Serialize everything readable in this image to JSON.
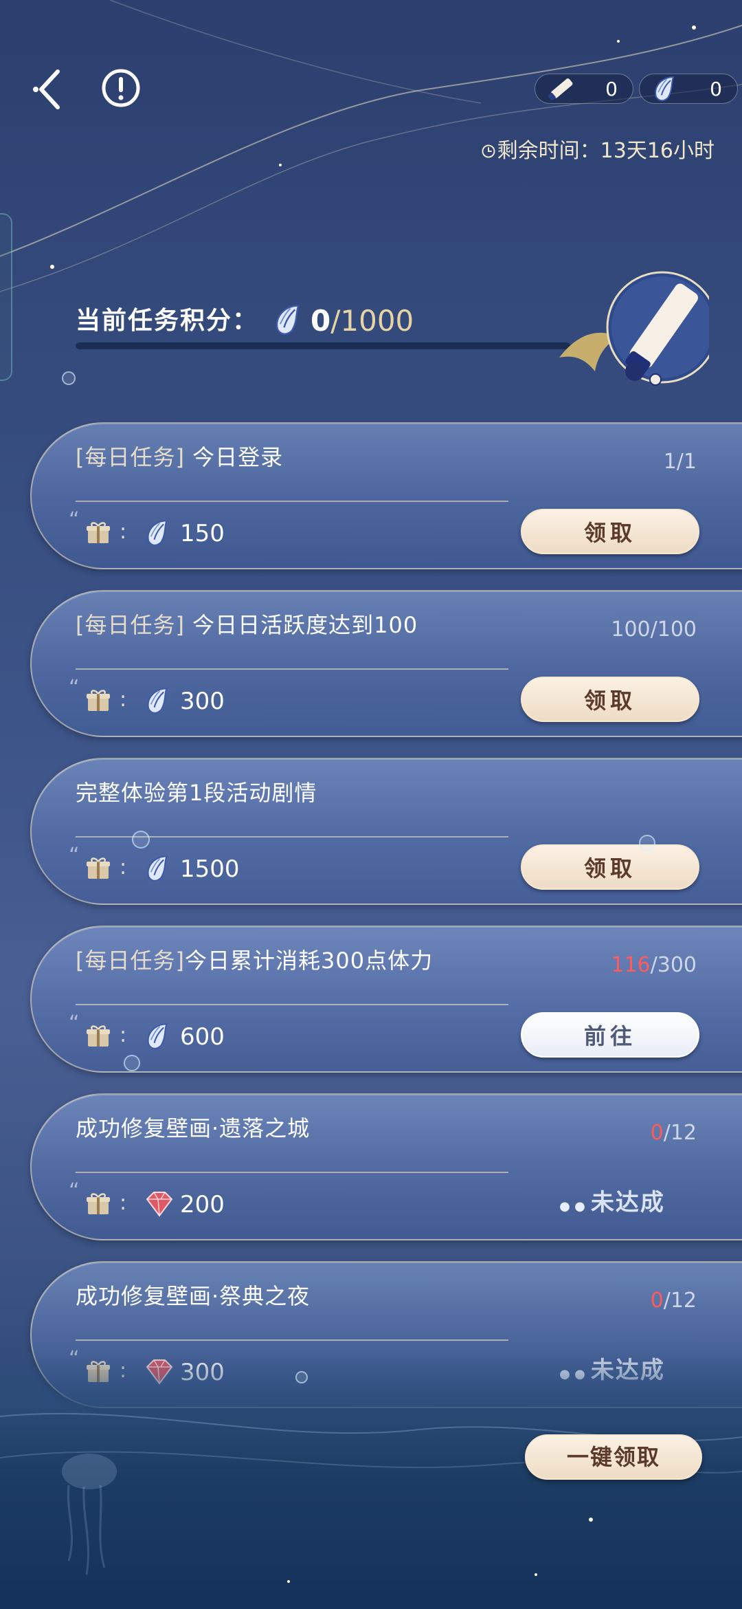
{
  "header": {
    "back_icon": "back-arrow-icon",
    "help_icon": "exclamation-circle-icon",
    "currencies": [
      {
        "icon": "lotion-tube-icon",
        "value": "0"
      },
      {
        "icon": "conch-shell-icon",
        "value": "0"
      }
    ],
    "timer_label": "剩余时间：",
    "timer_value": "13天16小时"
  },
  "score": {
    "label": "当前任务积分：",
    "current": "0",
    "max": "/1000",
    "progress_fraction": 0.0,
    "reward_icon": "lotion-tube-reward-icon"
  },
  "tasks": [
    {
      "tag": "[每日任务]",
      "name": " 今日登录",
      "progress_done": "1",
      "progress_rest": "/1",
      "reward_icon": "conch-shell-icon",
      "reward_amount": "150",
      "action": "claim",
      "action_label": "领取"
    },
    {
      "tag": "[每日任务]",
      "name": " 今日日活跃度达到100",
      "progress_done": "100",
      "progress_rest": "/100",
      "reward_icon": "conch-shell-icon",
      "reward_amount": "300",
      "action": "claim",
      "action_label": "领取"
    },
    {
      "tag": "",
      "name": "完整体验第1段活动剧情",
      "progress_done": "",
      "progress_rest": "",
      "reward_icon": "conch-shell-icon",
      "reward_amount": "1500",
      "action": "claim",
      "action_label": "领取"
    },
    {
      "tag": "[每日任务]",
      "name": "今日累计消耗300点体力",
      "progress_done": "116",
      "progress_rest": "/300",
      "reward_icon": "conch-shell-icon",
      "reward_amount": "600",
      "action": "goto",
      "action_label": "前往"
    },
    {
      "tag": "",
      "name": "成功修复壁画·遗落之城",
      "progress_done": "0",
      "progress_rest": "/12",
      "reward_icon": "red-gem-icon",
      "reward_amount": "200",
      "action": "status",
      "action_label": "未达成"
    },
    {
      "tag": "",
      "name": "成功修复壁画·祭典之夜",
      "progress_done": "0",
      "progress_rest": "/12",
      "reward_icon": "red-gem-icon",
      "reward_amount": "300",
      "action": "status",
      "action_label": "未达成"
    }
  ],
  "footer": {
    "claim_all_label": "一键领取"
  },
  "colors": {
    "accent_gold": "#e7d3a6",
    "progress_red": "#ff5b5b",
    "button_cream": "#f4e6d4",
    "button_text": "#5b3a2b"
  }
}
